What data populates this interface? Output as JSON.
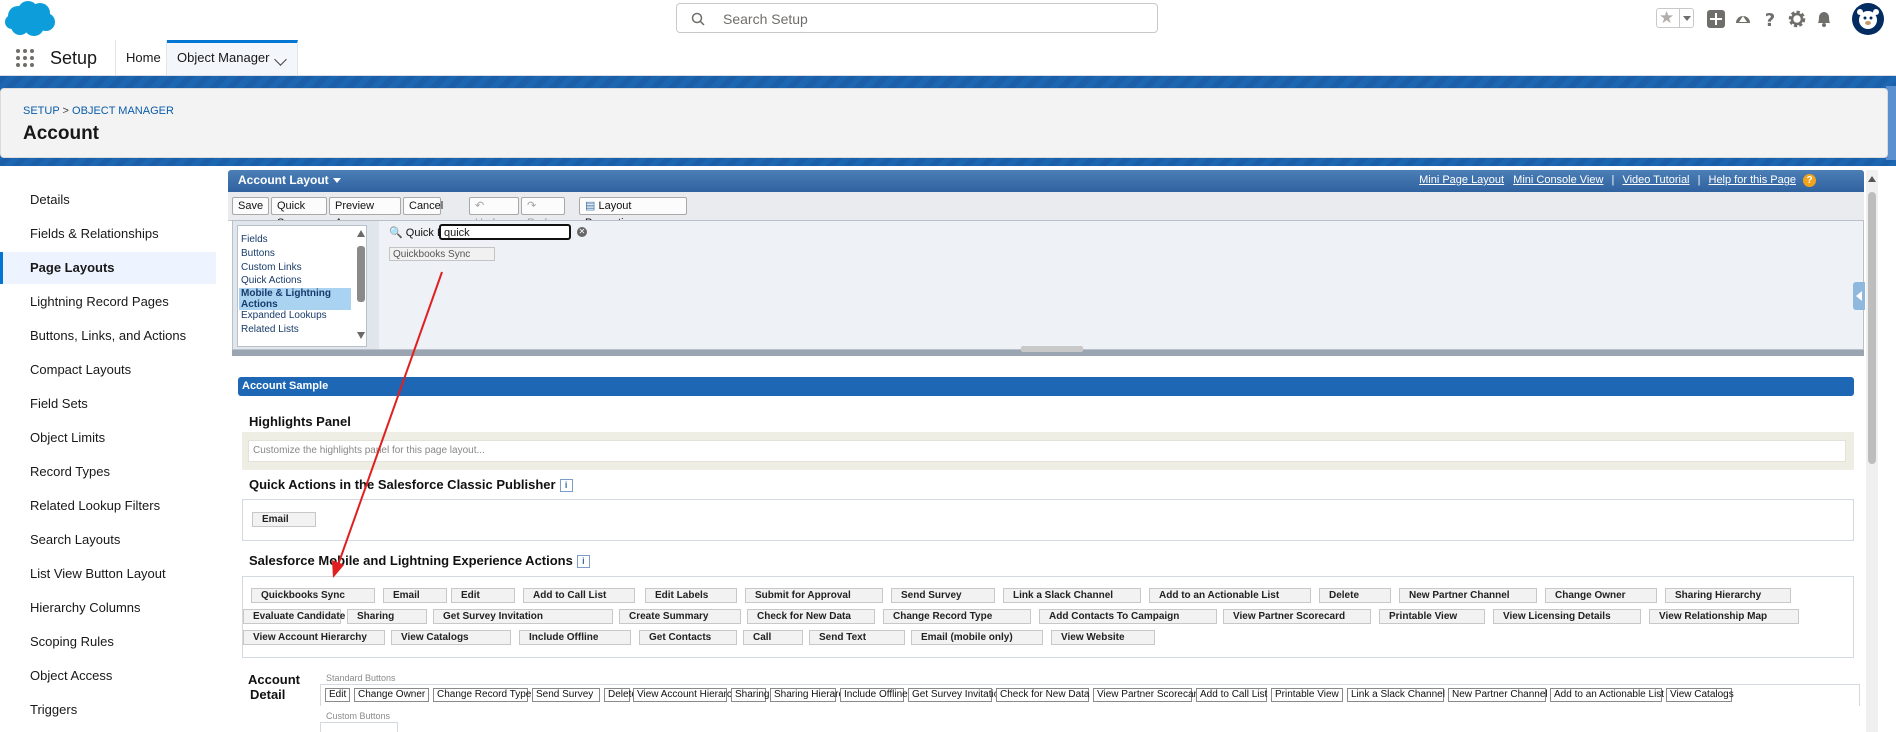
{
  "header": {
    "search_placeholder": "Search Setup",
    "brand_color": "#0176d3"
  },
  "nav": {
    "app_name": "Setup",
    "tabs": [
      {
        "label": "Home"
      },
      {
        "label": "Object Manager"
      }
    ]
  },
  "breadcrumb": {
    "setup": "SETUP",
    "sep": ">",
    "object_manager": "OBJECT MANAGER"
  },
  "object_title": "Account",
  "sidebar": {
    "items": [
      {
        "label": "Details"
      },
      {
        "label": "Fields & Relationships"
      },
      {
        "label": "Page Layouts"
      },
      {
        "label": "Lightning Record Pages"
      },
      {
        "label": "Buttons, Links, and Actions"
      },
      {
        "label": "Compact Layouts"
      },
      {
        "label": "Field Sets"
      },
      {
        "label": "Object Limits"
      },
      {
        "label": "Record Types"
      },
      {
        "label": "Related Lookup Filters"
      },
      {
        "label": "Search Layouts"
      },
      {
        "label": "List View Button Layout"
      },
      {
        "label": "Hierarchy Columns"
      },
      {
        "label": "Scoping Rules"
      },
      {
        "label": "Object Access"
      },
      {
        "label": "Triggers"
      }
    ],
    "active_index": 2
  },
  "layout_editor": {
    "title": "Account Layout",
    "top_links": [
      "Mini Page Layout",
      "Mini Console View",
      "Video Tutorial",
      "Help for this Page"
    ],
    "help_glyph": "?",
    "toolbar": {
      "save": "Save",
      "quick_save": "Quick Save",
      "preview_as": "Preview As...",
      "cancel": "Cancel",
      "undo": "Undo",
      "redo": "Redo",
      "layout_properties": "Layout Properties"
    },
    "palette": {
      "categories": [
        "Fields",
        "Buttons",
        "Custom Links",
        "Quick Actions",
        "Mobile & Lightning Actions",
        "Expanded Lookups",
        "Related Lists"
      ],
      "selected_index": 4,
      "quick_find_label": "Quick Find",
      "quick_find_value": "quick",
      "results": [
        "Quickbooks Sync"
      ]
    },
    "canvas": {
      "section_header": "Account Sample",
      "highlights_title": "Highlights Panel",
      "highlights_placeholder": "Customize the highlights panel for this page layout...",
      "classic_publisher_title": "Quick Actions in the Salesforce Classic Publisher",
      "classic_actions": [
        "Email"
      ],
      "lightning_title": "Salesforce Mobile and Lightning Experience Actions",
      "lightning_actions": [
        [
          "Quickbooks Sync",
          "Email",
          "Edit",
          "Add to Call List",
          "Edit Labels",
          "Submit for Approval",
          "Send Survey",
          "Link a Slack Channel",
          "Add to an Actionable List",
          "Delete",
          "New Partner Channel",
          "Change Owner",
          "Sharing Hierarchy"
        ],
        [
          "Evaluate Candidate",
          "Sharing",
          "Get Survey Invitation",
          "Create Summary",
          "Check for New Data",
          "Change Record Type",
          "Add Contacts To Campaign",
          "View Partner Scorecard",
          "Printable View",
          "View Licensing Details",
          "View Relationship Map"
        ],
        [
          "View Account Hierarchy",
          "View Catalogs",
          "Include Offline",
          "Get Contacts",
          "Call",
          "Send Text",
          "Email (mobile only)",
          "View Website"
        ]
      ],
      "detail_title_1": "Account",
      "detail_title_2": "Detail",
      "standard_buttons_label": "Standard Buttons",
      "standard_buttons": [
        "Edit",
        "Change Owner",
        "Change Record Type",
        "Send Survey",
        "Delete",
        "View Account Hierarchy",
        "Sharing",
        "Sharing Hierarchy",
        "Include Offline",
        "Get Survey Invitation",
        "Check for New Data",
        "View Partner Scorecard",
        "Add to Call List",
        "Printable View",
        "Link a Slack Channel",
        "New Partner Channel",
        "Add to an Actionable List",
        "View Catalogs"
      ],
      "custom_buttons_label": "Custom Buttons"
    }
  },
  "annotation": {
    "color": "#e02020"
  }
}
